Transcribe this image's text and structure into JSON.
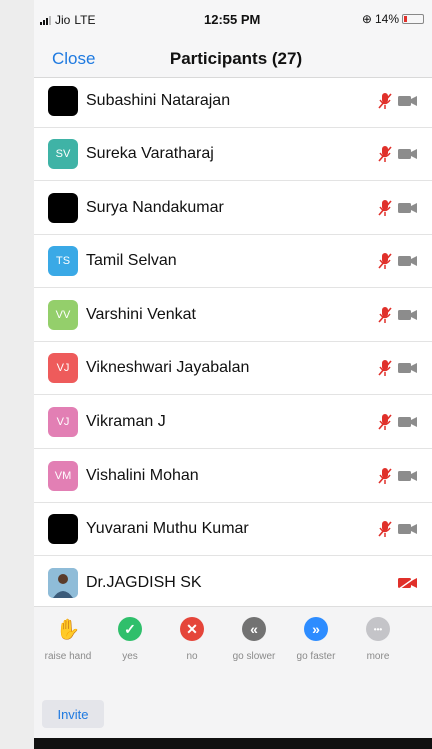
{
  "status_bar": {
    "carrier": "Jio",
    "network": "LTE",
    "time": "12:55 PM",
    "battery": "14%"
  },
  "nav": {
    "close_label": "Close",
    "title": "Participants (27)"
  },
  "participants": [
    {
      "name": "Subashini Natarajan",
      "initials": "",
      "avatar_color": "#000000",
      "camera_muted": false
    },
    {
      "name": "Sureka Varatharaj",
      "initials": "SV",
      "avatar_color": "#3fb3a6",
      "camera_muted": false
    },
    {
      "name": "Surya Nandakumar",
      "initials": "",
      "avatar_color": "#000000",
      "camera_muted": false
    },
    {
      "name": "Tamil Selvan",
      "initials": "TS",
      "avatar_color": "#3aa9e6",
      "camera_muted": false
    },
    {
      "name": "Varshini Venkat",
      "initials": "VV",
      "avatar_color": "#94cf6b",
      "camera_muted": false
    },
    {
      "name": "Vikneshwari Jayabalan",
      "initials": "VJ",
      "avatar_color": "#ee5b5b",
      "camera_muted": false
    },
    {
      "name": "Vikraman J",
      "initials": "VJ",
      "avatar_color": "#e27fb4",
      "camera_muted": false
    },
    {
      "name": "Vishalini Mohan",
      "initials": "VM",
      "avatar_color": "#e27fb4",
      "camera_muted": false
    },
    {
      "name": "Yuvarani Muthu Kumar",
      "initials": "",
      "avatar_color": "#000000",
      "camera_muted": false
    },
    {
      "name": "Dr.JAGDISH SK",
      "initials": "",
      "avatar_color": "#6fa6c9",
      "camera_muted": true,
      "mic_hidden": true
    }
  ],
  "reactions": [
    {
      "label": "raise hand",
      "icon": "hand-icon",
      "color": "#2d8cff",
      "glyph": "✋"
    },
    {
      "label": "yes",
      "icon": "check-icon",
      "color": "#2fbf6b",
      "glyph": "✓"
    },
    {
      "label": "no",
      "icon": "x-icon",
      "color": "#e5453a",
      "glyph": "✕"
    },
    {
      "label": "go slower",
      "icon": "rewind-icon",
      "color": "#727272",
      "glyph": "«"
    },
    {
      "label": "go faster",
      "icon": "fast-forward-icon",
      "color": "#2d8cff",
      "glyph": "»"
    },
    {
      "label": "more",
      "icon": "more-icon",
      "color": "#c4c4c8",
      "glyph": "•••"
    }
  ],
  "footer": {
    "invite_label": "Invite"
  },
  "colors": {
    "accent": "#1f7ae0",
    "muted_red": "#e0302a",
    "icon_gray": "#8c8c8c"
  }
}
